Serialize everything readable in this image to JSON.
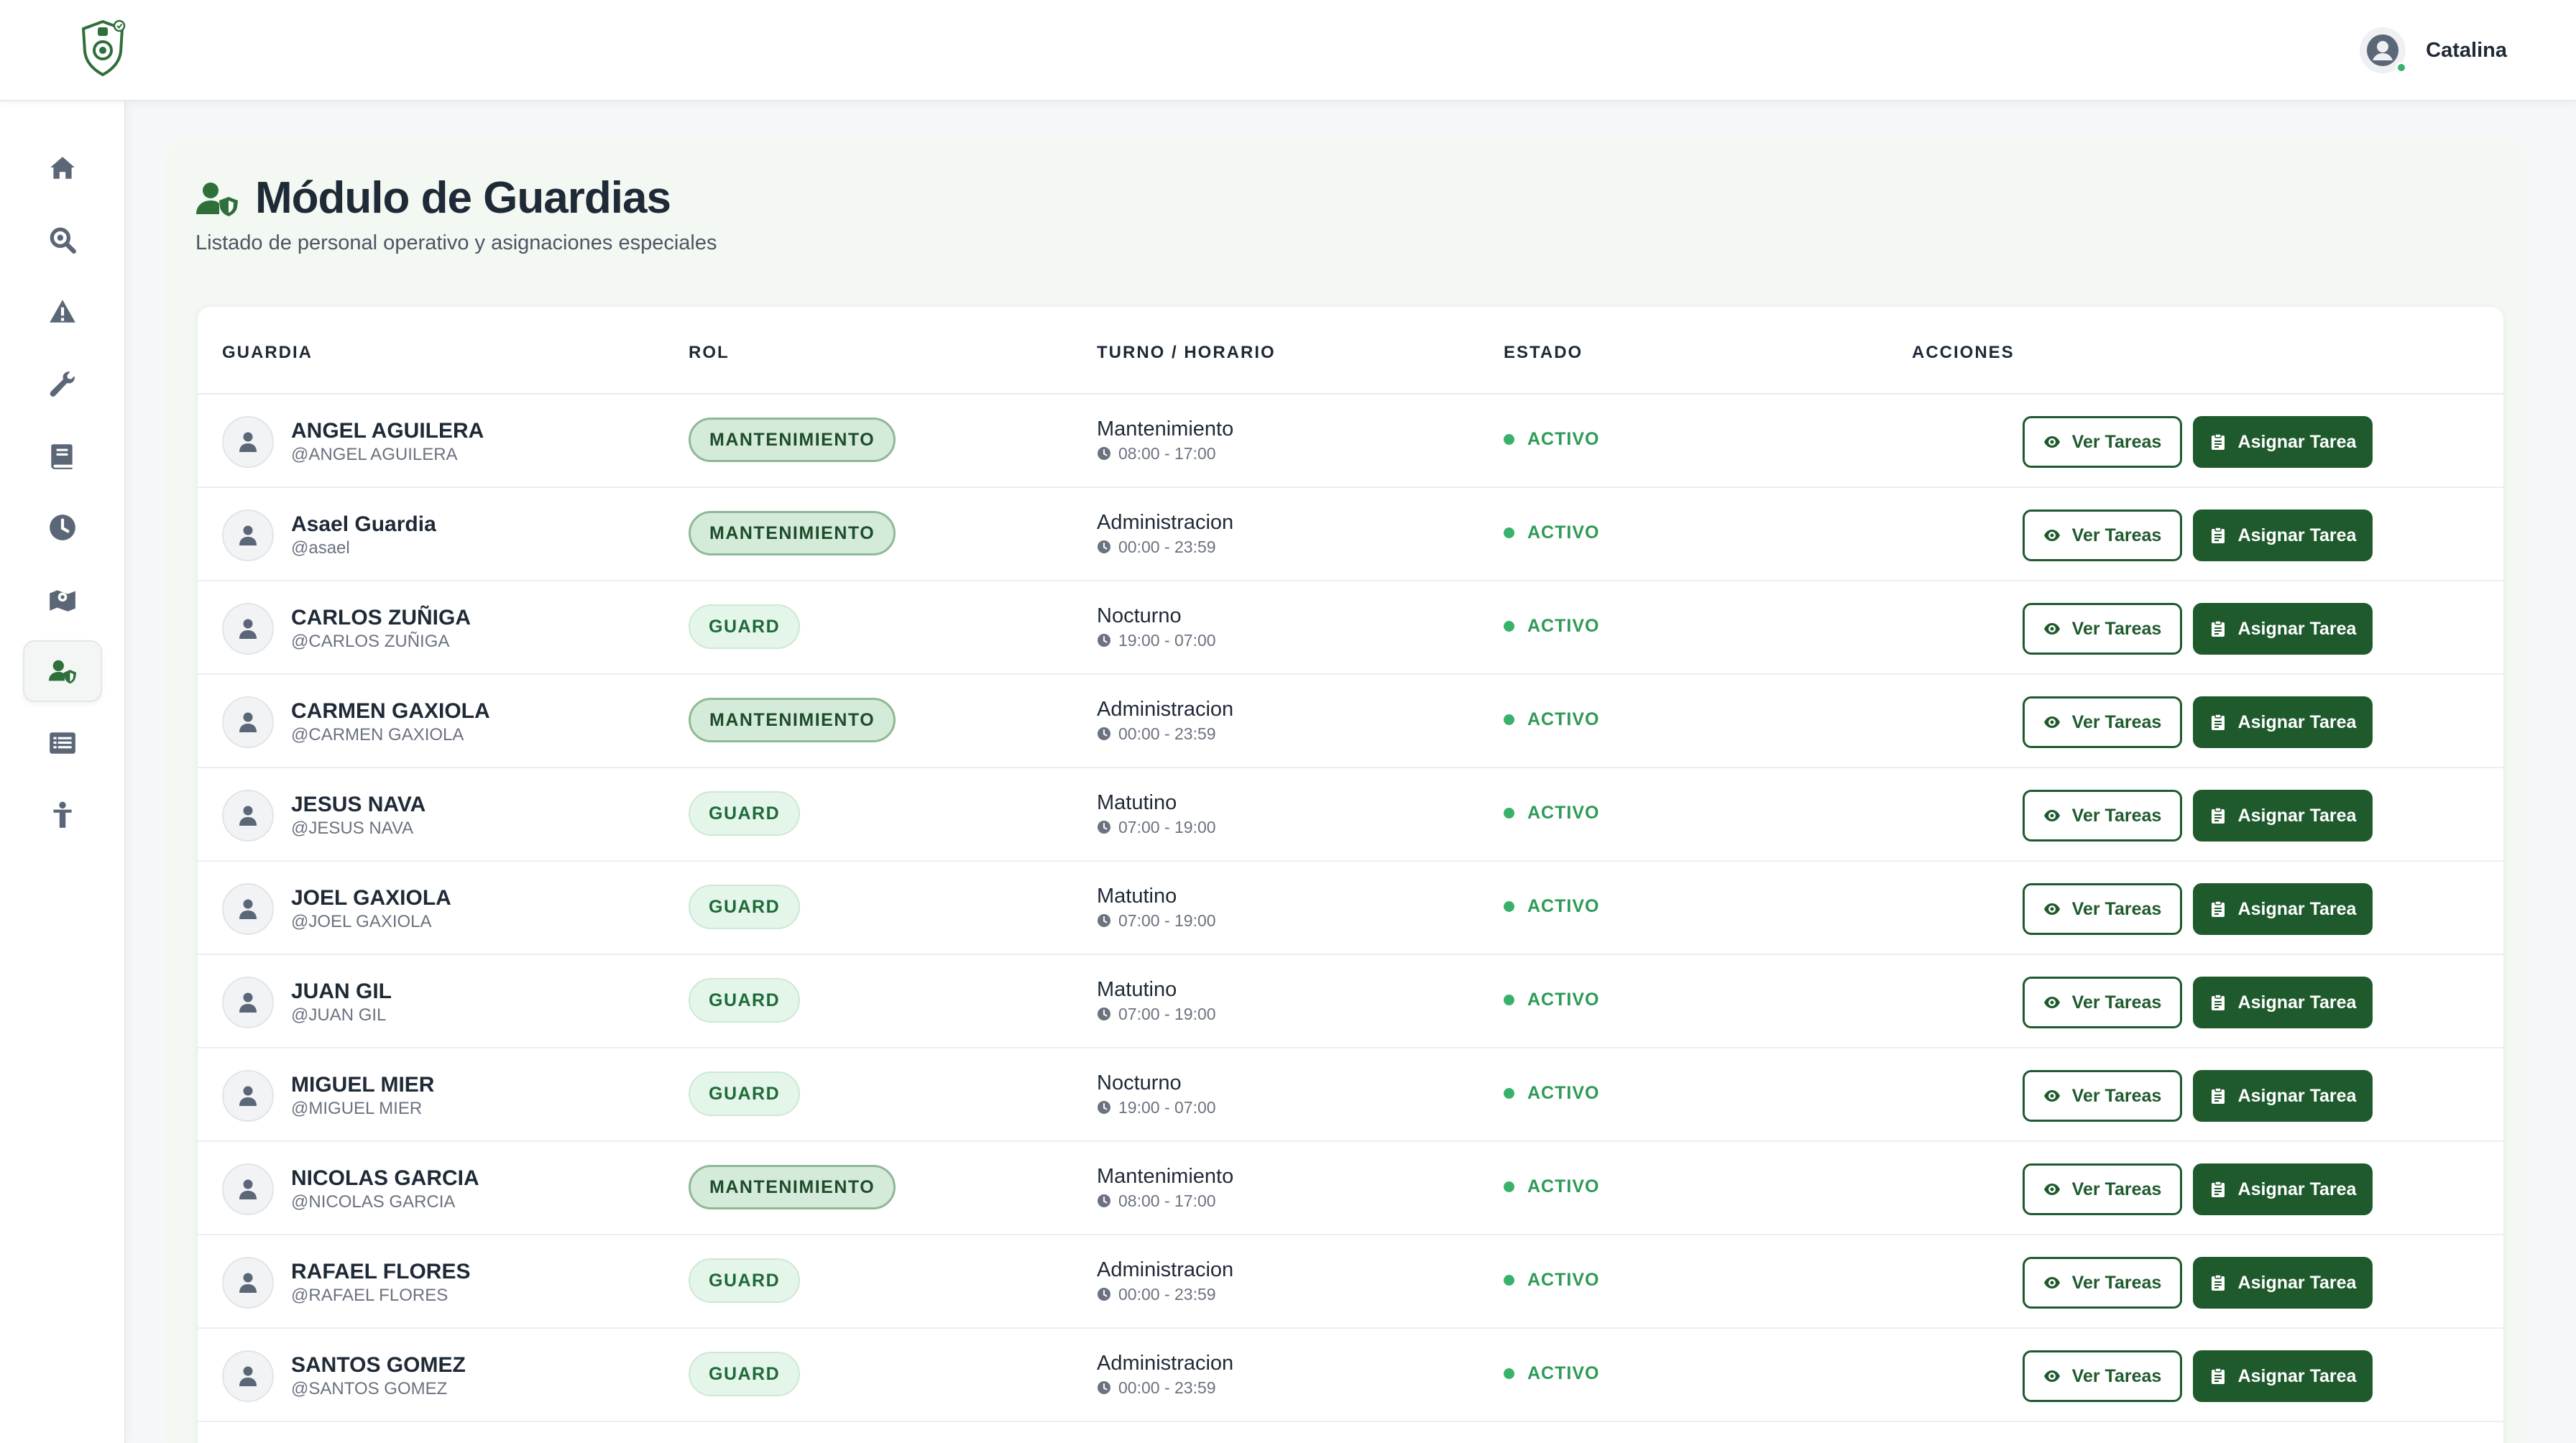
{
  "app": {
    "user_name": "Catalina"
  },
  "sidebar": {
    "items": [
      {
        "icon": "home-icon",
        "active": false
      },
      {
        "icon": "search-icon",
        "active": false
      },
      {
        "icon": "warning-icon",
        "active": false
      },
      {
        "icon": "wrench-icon",
        "active": false
      },
      {
        "icon": "book-icon",
        "active": false
      },
      {
        "icon": "clock-icon",
        "active": false
      },
      {
        "icon": "map-pin-icon",
        "active": false
      },
      {
        "icon": "user-shield-icon",
        "active": true
      },
      {
        "icon": "list-icon",
        "active": false
      },
      {
        "icon": "person-icon",
        "active": false
      }
    ]
  },
  "page": {
    "title": "Módulo de Guardias",
    "subtitle": "Listado de personal operativo y asignaciones especiales"
  },
  "table": {
    "headers": {
      "guard": "GUARDIA",
      "role": "ROL",
      "shift": "TURNO / HORARIO",
      "status": "ESTADO",
      "actions": "ACCIONES"
    },
    "view_label": "Ver Tareas",
    "assign_label": "Asignar Tarea",
    "rows": [
      {
        "name": "ANGEL AGUILERA",
        "handle": "@ANGEL AGUILERA",
        "role": "MANTENIMIENTO",
        "shift": "Mantenimiento",
        "hours": "08:00 - 17:00",
        "status": "ACTIVO"
      },
      {
        "name": "Asael Guardia",
        "handle": "@asael",
        "role": "MANTENIMIENTO",
        "shift": "Administracion",
        "hours": "00:00 - 23:59",
        "status": "ACTIVO"
      },
      {
        "name": "CARLOS ZUÑIGA",
        "handle": "@CARLOS ZUÑIGA",
        "role": "GUARD",
        "shift": "Nocturno",
        "hours": "19:00 - 07:00",
        "status": "ACTIVO"
      },
      {
        "name": "CARMEN GAXIOLA",
        "handle": "@CARMEN GAXIOLA",
        "role": "MANTENIMIENTO",
        "shift": "Administracion",
        "hours": "00:00 - 23:59",
        "status": "ACTIVO"
      },
      {
        "name": "JESUS NAVA",
        "handle": "@JESUS NAVA",
        "role": "GUARD",
        "shift": "Matutino",
        "hours": "07:00 - 19:00",
        "status": "ACTIVO"
      },
      {
        "name": "JOEL GAXIOLA",
        "handle": "@JOEL GAXIOLA",
        "role": "GUARD",
        "shift": "Matutino",
        "hours": "07:00 - 19:00",
        "status": "ACTIVO"
      },
      {
        "name": "JUAN GIL",
        "handle": "@JUAN GIL",
        "role": "GUARD",
        "shift": "Matutino",
        "hours": "07:00 - 19:00",
        "status": "ACTIVO"
      },
      {
        "name": "MIGUEL MIER",
        "handle": "@MIGUEL MIER",
        "role": "GUARD",
        "shift": "Nocturno",
        "hours": "19:00 - 07:00",
        "status": "ACTIVO"
      },
      {
        "name": "NICOLAS GARCIA",
        "handle": "@NICOLAS GARCIA",
        "role": "MANTENIMIENTO",
        "shift": "Mantenimiento",
        "hours": "08:00 - 17:00",
        "status": "ACTIVO"
      },
      {
        "name": "RAFAEL FLORES",
        "handle": "@RAFAEL FLORES",
        "role": "GUARD",
        "shift": "Administracion",
        "hours": "00:00 - 23:59",
        "status": "ACTIVO"
      },
      {
        "name": "SANTOS GOMEZ",
        "handle": "@SANTOS GOMEZ",
        "role": "GUARD",
        "shift": "Administracion",
        "hours": "00:00 - 23:59",
        "status": "ACTIVO"
      }
    ]
  },
  "colors": {
    "brand_green": "#1e5a2c",
    "status_green": "#2e9a56",
    "icon_gray": "#5b6676"
  }
}
